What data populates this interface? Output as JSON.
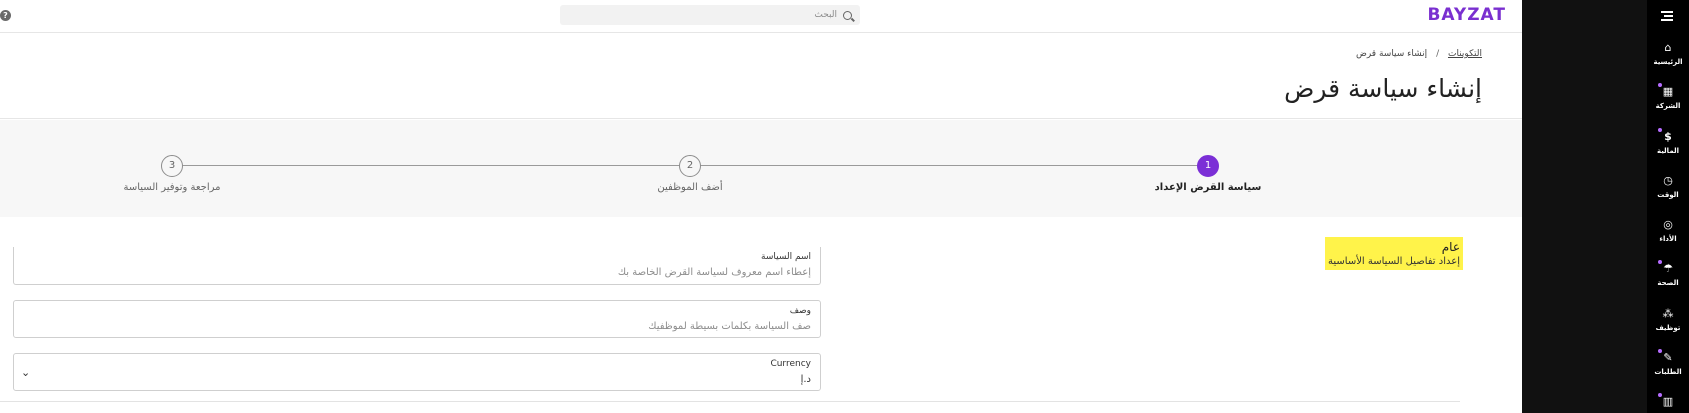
{
  "brand": {
    "logo_text": "BAYZAT",
    "accent": "#7b2fd6"
  },
  "search": {
    "placeholder": "البحث"
  },
  "help": {
    "glyph": "?"
  },
  "breadcrumb": {
    "parent": "التكوينات",
    "separator": "/",
    "current": "إنشاء سياسة قرض"
  },
  "page_title": "إنشاء سياسة قرض",
  "stepper": {
    "steps": [
      {
        "number": "1",
        "label": "سياسة القرض الإعداد",
        "active": true
      },
      {
        "number": "2",
        "label": "أضف الموظفين",
        "active": false
      },
      {
        "number": "3",
        "label": "مراجعة وتوفير السياسة",
        "active": false
      }
    ]
  },
  "section": {
    "title": "عام",
    "subtitle": "إعداد تفاصيل السياسة الأساسية",
    "highlight": "#fff34a"
  },
  "form": {
    "policy_name": {
      "label": "اسم السياسة",
      "placeholder": "إعطاء اسم معروف لسياسة القرض الخاصة بك"
    },
    "description": {
      "label": "وصف",
      "placeholder": "صف السياسة بكلمات بسيطة لموظفيك"
    },
    "currency": {
      "label": "Currency",
      "value": "د.إ",
      "chevron": "⌄"
    }
  },
  "sidebar": {
    "items": [
      {
        "label": "الرئيسية",
        "icon": "home-icon",
        "glyph": "⌂",
        "dot": false
      },
      {
        "label": "الشركة",
        "icon": "building-icon",
        "glyph": "▦",
        "dot": true
      },
      {
        "label": "المالية",
        "icon": "dollar-icon",
        "glyph": "$",
        "dot": true
      },
      {
        "label": "الوقت",
        "icon": "clock-icon",
        "glyph": "◷",
        "dot": false
      },
      {
        "label": "الأداء",
        "icon": "target-icon",
        "glyph": "◎",
        "dot": false
      },
      {
        "label": "الصحة",
        "icon": "umbrella-icon",
        "glyph": "☂",
        "dot": true
      },
      {
        "label": "توظيف",
        "icon": "people-icon",
        "glyph": "⁂",
        "dot": false
      },
      {
        "label": "الطلبات",
        "icon": "request-icon",
        "glyph": "✎",
        "dot": true
      },
      {
        "label": "",
        "icon": "chart-icon",
        "glyph": "▥",
        "dot": true
      }
    ]
  }
}
